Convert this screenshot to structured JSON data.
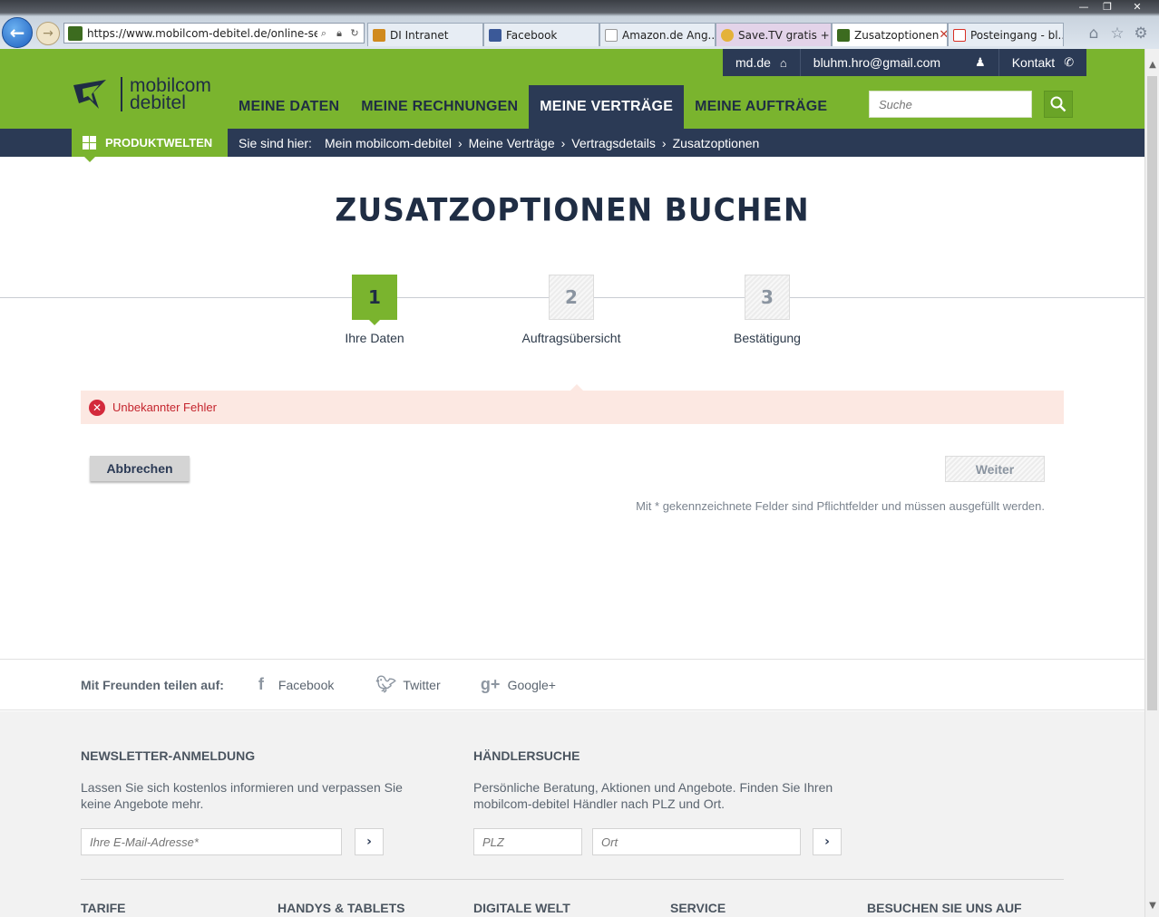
{
  "browser": {
    "url": "https://www.mobilcom-debitel.de/online-se",
    "tabs": [
      {
        "label": "DI Intranet",
        "color": "#d08a1e"
      },
      {
        "label": "Facebook",
        "color": "#3b5998"
      },
      {
        "label": "Amazon.de Ang...",
        "color": "#222222"
      },
      {
        "label": "Save.TV gratis + ...",
        "color": "#e4b23a"
      },
      {
        "label": "Zusatzoptionen",
        "color": "#3c6b1f"
      },
      {
        "label": "Posteingang - bl...",
        "color": "#d93025"
      }
    ],
    "window_controls": {
      "minimize": "—",
      "restore": "❐",
      "close": "✕"
    },
    "icons": {
      "back": "back-arrow-icon",
      "forward": "forward-arrow-icon",
      "home": "home-icon",
      "favorites": "star-icon",
      "tools": "gear-icon"
    }
  },
  "header": {
    "topbar": {
      "site": "md.de",
      "email": "bluhm.hro@gmail.com",
      "contact": "Kontakt"
    },
    "logo": {
      "line1": "mobilcom",
      "line2": "debitel"
    },
    "nav": [
      "MEINE DATEN",
      "MEINE RECHNUNGEN",
      "MEINE VERTRÄGE",
      "MEINE AUFTRÄGE"
    ],
    "active_nav": "MEINE VERTRÄGE",
    "search_placeholder": "Suche"
  },
  "breadcrumb": {
    "produktwelten": "PRODUKTWELTEN",
    "label": "Sie sind hier:",
    "items": [
      "Mein mobilcom-debitel",
      "Meine Verträge",
      "Vertragsdetails",
      "Zusatzoptionen"
    ],
    "separator": "›"
  },
  "title": "ZUSATZOPTIONEN BUCHEN",
  "steps": [
    {
      "number": "1",
      "label": "Ihre Daten",
      "active": true
    },
    {
      "number": "2",
      "label": "Auftragsübersicht",
      "active": false
    },
    {
      "number": "3",
      "label": "Bestätigung",
      "active": false
    }
  ],
  "error": {
    "message": "Unbekannter Fehler"
  },
  "buttons": {
    "cancel": "Abbrechen",
    "next": "Weiter"
  },
  "hint": "Mit * gekennzeichnete Felder sind Pflichtfelder und müssen ausgefüllt werden.",
  "share": {
    "label": "Mit Freunden teilen auf:",
    "items": [
      "Facebook",
      "Twitter",
      "Google+"
    ]
  },
  "footer": {
    "newsletter": {
      "heading": "NEWSLETTER-ANMELDUNG",
      "text": "Lassen Sie sich kostenlos informieren und verpassen Sie keine Angebote mehr.",
      "placeholder": "Ihre E-Mail-Adresse*"
    },
    "dealer": {
      "heading": "HÄNDLERSUCHE",
      "text": "Persönliche Beratung, Aktionen und Angebote. Finden Sie Ihren mobilcom-debitel Händler nach PLZ und Ort.",
      "plz_placeholder": "PLZ",
      "ort_placeholder": "Ort"
    },
    "columns": [
      "TARIFE",
      "HANDYS & TABLETS",
      "DIGITALE WELT",
      "SERVICE",
      "BESUCHEN SIE UNS AUF"
    ]
  },
  "colors": {
    "brand_green": "#7ab42e",
    "navy": "#2b3a55",
    "error": "#c4242d"
  }
}
